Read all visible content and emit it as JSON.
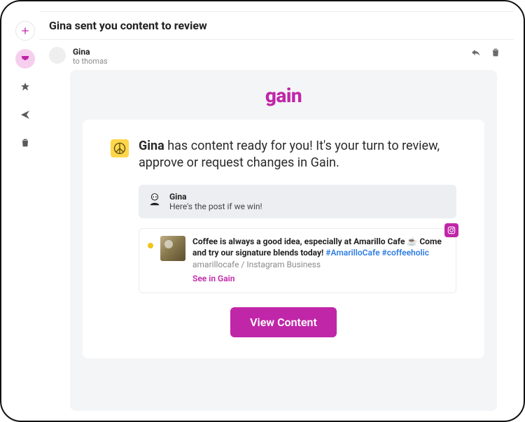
{
  "subject": "Gina sent you content to review",
  "header": {
    "from": "Gina",
    "to": "to thomas"
  },
  "brand": "gain",
  "intro": {
    "bold": "Gina",
    "rest": " has content ready for you! It's your turn to review, approve or request changes in Gain."
  },
  "note": {
    "name": "Gina",
    "text": "Here's the post if we win!"
  },
  "post": {
    "text": "Coffee is always a good idea, especially at Amarillo Cafe ☕ Come and try our signature blends today! ",
    "tags": "#AmarilloCafe #coffeeholic",
    "meta": "amarillocafe / Instagram Business",
    "link": "See in Gain"
  },
  "cta": "View Content"
}
